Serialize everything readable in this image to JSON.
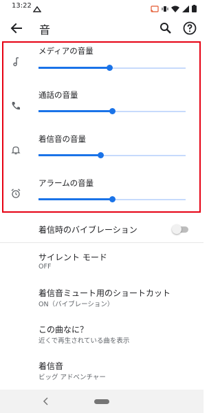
{
  "status_bar": {
    "time": "13:22",
    "icons": [
      "cast-icon",
      "vibrate-icon",
      "wifi-icon",
      "signal-icon",
      "battery-icon"
    ]
  },
  "app_bar": {
    "title": "音",
    "icons": [
      "back-arrow-icon",
      "search-icon",
      "help-icon"
    ]
  },
  "highlight_color": "#e60012",
  "accent_color": "#1a73e8",
  "volumes": [
    {
      "label": "メディアの音量",
      "icon": "music-note-icon",
      "level": 0.48
    },
    {
      "label": "通話の音量",
      "icon": "phone-icon",
      "level": 0.5
    },
    {
      "label": "着信音の音量",
      "icon": "bell-icon",
      "level": 0.42
    },
    {
      "label": "アラームの音量",
      "icon": "alarm-clock-icon",
      "level": 0.5
    }
  ],
  "settings": {
    "vibrate_on_ring": {
      "title": "着信時のバイブレーション",
      "enabled": false
    },
    "silent_mode": {
      "title": "サイレント モード",
      "value": "OFF"
    },
    "mute_shortcut": {
      "title": "着信音ミュート用のショートカット",
      "value": "ON（バイブレーション）"
    },
    "now_playing": {
      "title": "この曲なに？",
      "value": "近くで再生されている曲を表示"
    },
    "ringtone": {
      "title": "着信音",
      "value": "ビッグ アドベンチャー"
    }
  },
  "nav_bar": {
    "icons": [
      "nav-back-icon",
      "nav-home-pill"
    ]
  }
}
